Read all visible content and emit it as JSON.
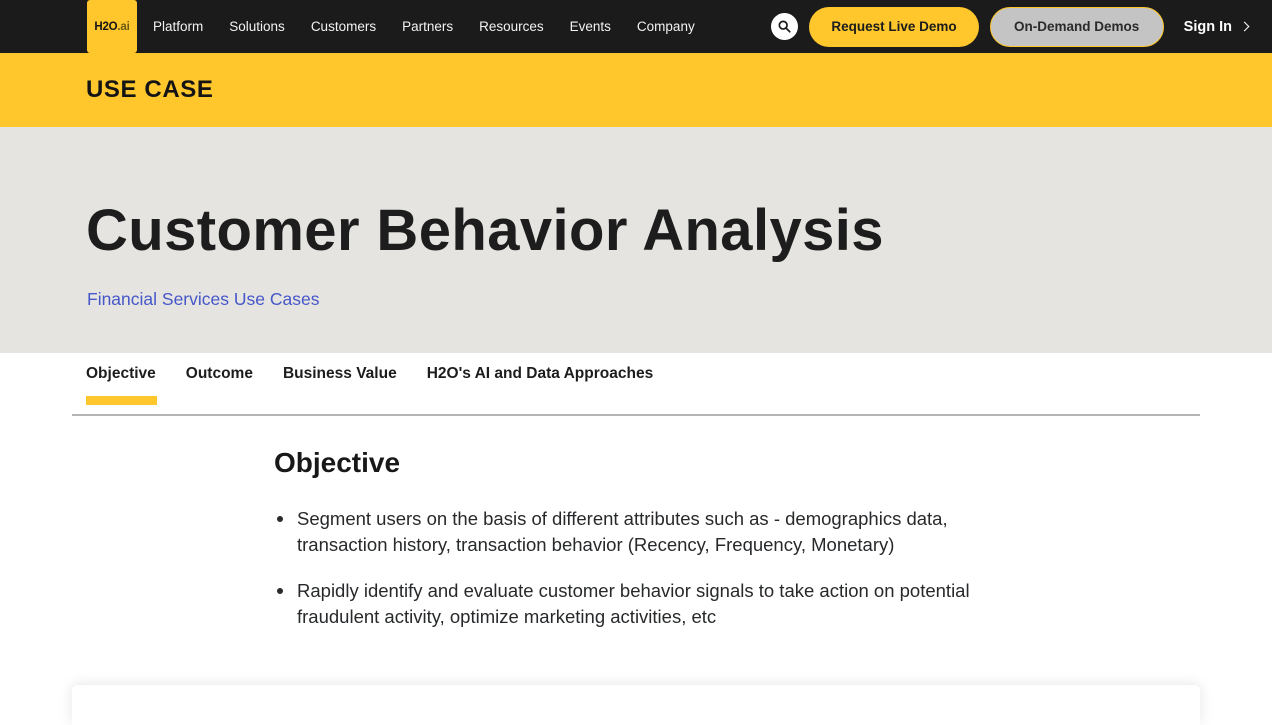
{
  "navbar": {
    "logo": {
      "main": "H2O",
      "suffix": ".ai"
    },
    "links": [
      {
        "label": "Platform"
      },
      {
        "label": "Solutions"
      },
      {
        "label": "Customers"
      },
      {
        "label": "Partners"
      },
      {
        "label": "Resources"
      },
      {
        "label": "Events"
      },
      {
        "label": "Company"
      }
    ],
    "search_icon": "search-icon",
    "primary_button": "Request Live Demo",
    "secondary_button": "On-Demand Demos",
    "signin_label": "Sign In",
    "signin_icon": "chevron-right-icon",
    "colors": {
      "background": "#1b1b1b",
      "accent": "#ffc72c",
      "secondary_fill": "#c4c4c4"
    }
  },
  "eyebrow": {
    "label": "USE CASE",
    "background": "#ffc72c"
  },
  "hero": {
    "title": "Customer Behavior Analysis",
    "subtitle_link": "Financial Services Use Cases",
    "background": "#e5e4e1",
    "link_color": "#4657c9"
  },
  "tabs": [
    {
      "label": "Objective",
      "active": true
    },
    {
      "label": "Outcome",
      "active": false
    },
    {
      "label": "Business Value",
      "active": false
    },
    {
      "label": "H2O's AI and Data Approaches",
      "active": false
    }
  ],
  "content": {
    "section_title": "Objective",
    "bullets": [
      "Segment users on the basis of different attributes such as - demographics data, transaction history, transaction behavior (Recency, Frequency, Monetary)",
      "Rapidly identify and evaluate customer behavior signals to take action on potential fraudulent activity, optimize marketing activities, etc"
    ]
  }
}
